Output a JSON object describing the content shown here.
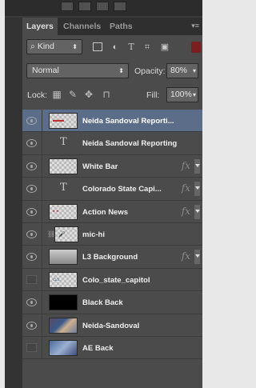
{
  "tabs": [
    {
      "label": "Layers",
      "active": true
    },
    {
      "label": "Channels",
      "active": false
    },
    {
      "label": "Paths",
      "active": false
    }
  ],
  "filter": {
    "kind_label": "Kind",
    "search_icon": "search-icon",
    "filter_icons": [
      "image-icon",
      "adjustment-icon",
      "type-icon",
      "shape-icon",
      "smart-object-icon"
    ]
  },
  "blend": {
    "mode": "Normal",
    "opacity_label": "Opacity:",
    "opacity_value": "80%"
  },
  "lock": {
    "label": "Lock:",
    "fill_label": "Fill:",
    "fill_value": "100%"
  },
  "layers": [
    {
      "name": "Neida Sandoval Reporti...",
      "visible": true,
      "kind": "image",
      "selected": true,
      "fx": false
    },
    {
      "name": "Neida Sandoval Reporting",
      "visible": true,
      "kind": "text",
      "selected": false,
      "fx": false
    },
    {
      "name": "White Bar",
      "visible": true,
      "kind": "image",
      "selected": false,
      "fx": true
    },
    {
      "name": "Colorado State Capi...",
      "visible": true,
      "kind": "text",
      "selected": false,
      "fx": true
    },
    {
      "name": "Action News",
      "visible": true,
      "kind": "image",
      "selected": false,
      "fx": true
    },
    {
      "name": "mic-hi",
      "visible": true,
      "kind": "image-linked",
      "selected": false,
      "fx": false
    },
    {
      "name": "L3 Background",
      "visible": true,
      "kind": "image",
      "selected": false,
      "fx": true
    },
    {
      "name": "Colo_state_capitol",
      "visible": false,
      "kind": "image",
      "selected": false,
      "fx": false
    },
    {
      "name": "Black Back",
      "visible": true,
      "kind": "black",
      "selected": false,
      "fx": false
    },
    {
      "name": "Neida-Sandoval",
      "visible": true,
      "kind": "photo",
      "selected": false,
      "fx": false
    },
    {
      "name": "AE Back",
      "visible": false,
      "kind": "photo2",
      "selected": false,
      "fx": false
    }
  ],
  "fx_symbol": "fx",
  "type_symbol": "T",
  "selection_color": "#5c6d8a"
}
